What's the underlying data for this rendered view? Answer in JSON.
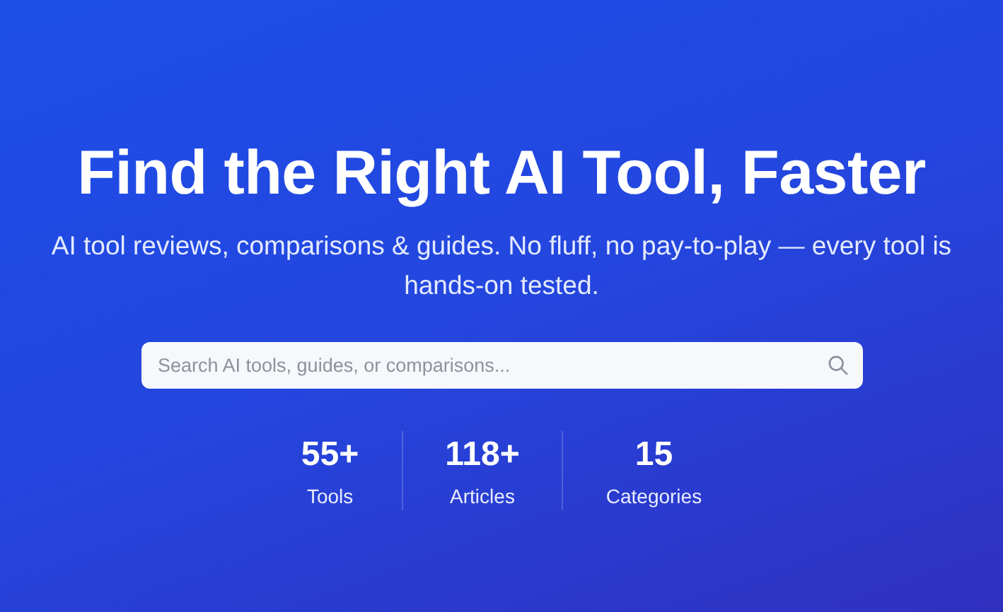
{
  "hero": {
    "title": "Find the Right AI Tool, Faster",
    "subtitle": "AI tool reviews, comparisons & guides. No fluff, no pay-to-play — every tool is hands-on tested."
  },
  "search": {
    "placeholder": "Search AI tools, guides, or comparisons..."
  },
  "stats": [
    {
      "value": "55+",
      "label": "Tools"
    },
    {
      "value": "118+",
      "label": "Articles"
    },
    {
      "value": "15",
      "label": "Categories"
    }
  ]
}
